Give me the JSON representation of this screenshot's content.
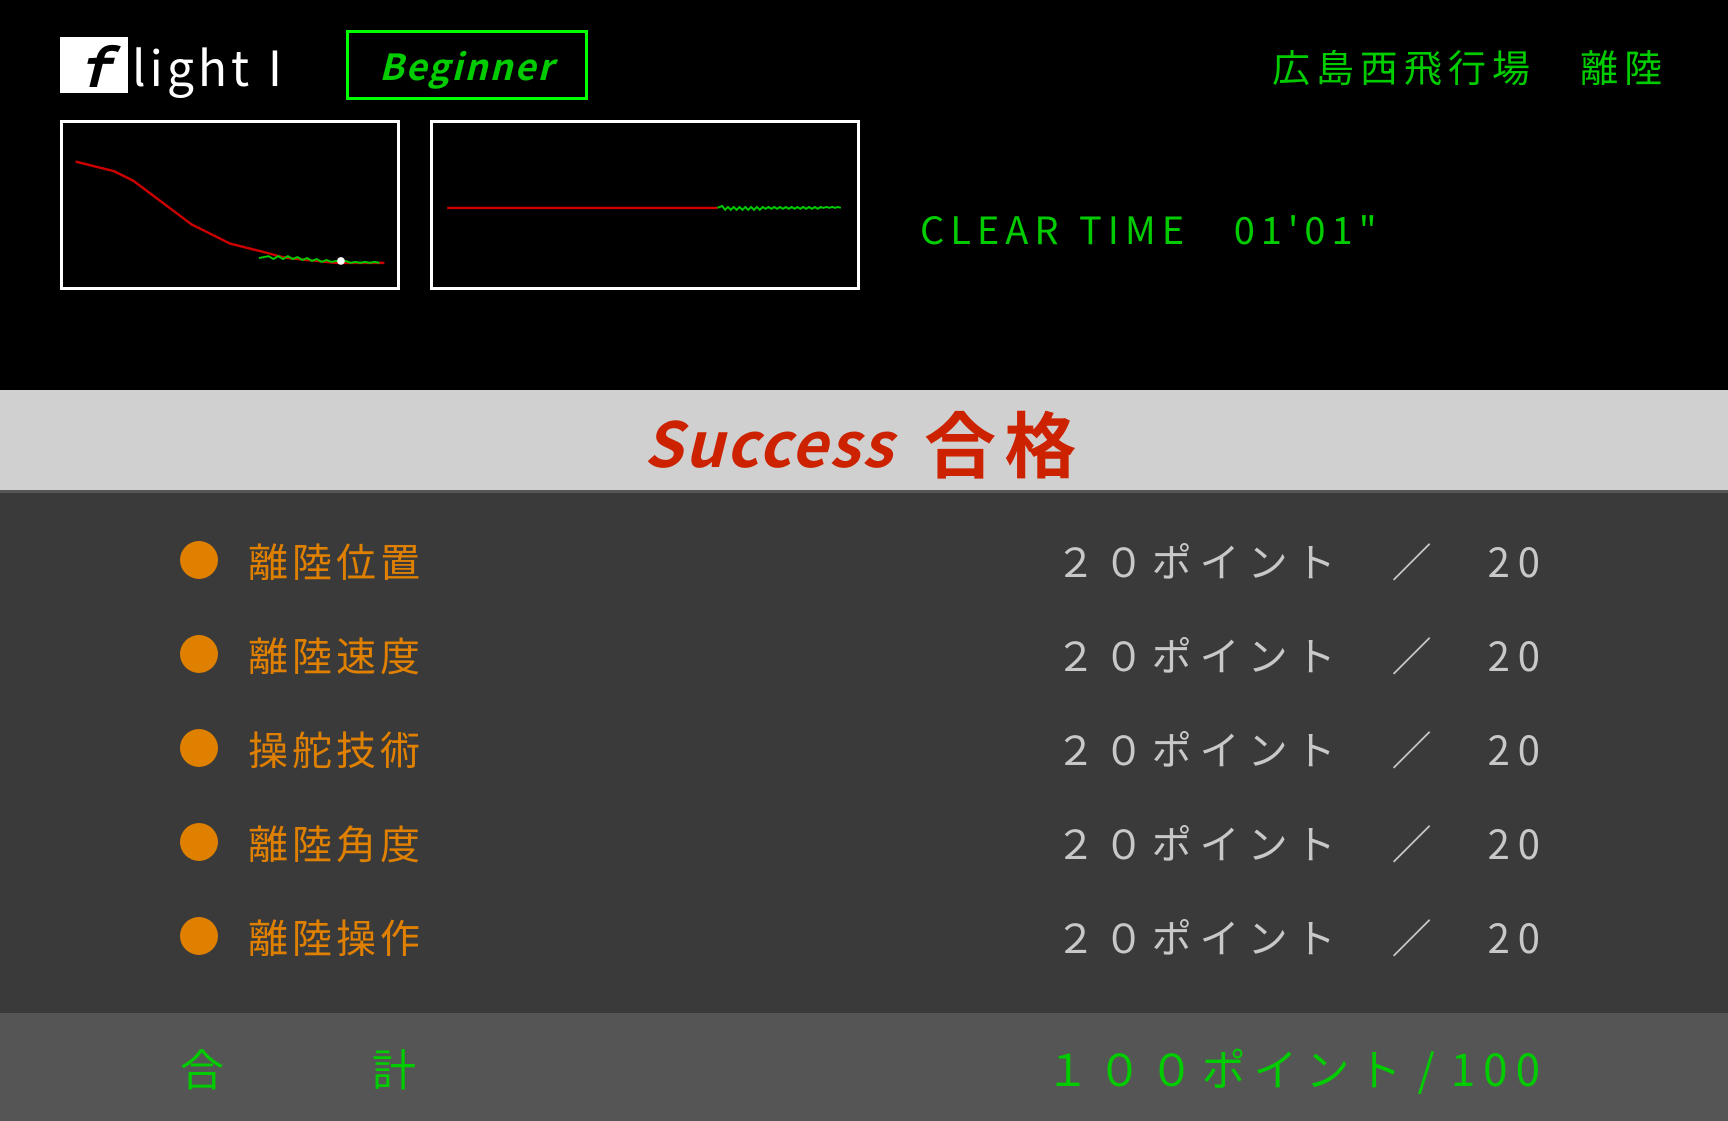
{
  "header": {
    "logo_f": "ｆ",
    "logo_rest": "light I",
    "badge": "Beginner",
    "airport": "広島西飛行場　離陸"
  },
  "clear_time": {
    "label": "CLEAR TIME",
    "value": "01'01\""
  },
  "success": {
    "english": "Success",
    "japanese": "合格"
  },
  "scores": [
    {
      "label": "離陸位置",
      "value": "２０ポイント",
      "max": "20"
    },
    {
      "label": "離陸速度",
      "value": "２０ポイント",
      "max": "20"
    },
    {
      "label": "操舵技術",
      "value": "２０ポイント",
      "max": "20"
    },
    {
      "label": "離陸角度",
      "value": "２０ポイント",
      "max": "20"
    },
    {
      "label": "離陸操作",
      "value": "２０ポイント",
      "max": "20"
    }
  ],
  "total": {
    "label": "合　　計",
    "value": "１００ポイント",
    "slash": "/",
    "max": "100"
  }
}
